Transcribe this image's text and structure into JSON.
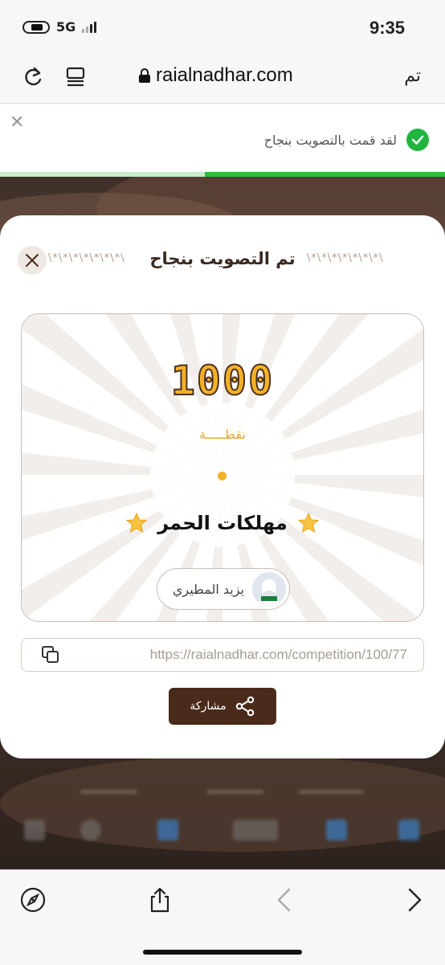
{
  "status_bar": {
    "network": "5G",
    "time": "9:35"
  },
  "browser": {
    "url": "raialnadhar.com",
    "done_label": "تم"
  },
  "toast": {
    "message": "لقد قمت بالتصويت بنجاح",
    "progress": 0.54
  },
  "modal": {
    "title": "تم التصويت بنجاح",
    "decoration": "\\*\\*\\*\\*\\*\\*\\*\\",
    "points": "1000",
    "points_label": "نقطـــــة",
    "team_name": "مهلكات الحمر",
    "user_name": "يزيد المطيري",
    "share_link": "https://raialnadhar.com/competition/100/77",
    "share_label": "مشاركة"
  },
  "colors": {
    "brand_brown": "#4a2b1b",
    "gold": "#f4b128",
    "success_green": "#1fb53f"
  },
  "icons": {
    "status": [
      "battery-icon",
      "signal-icon"
    ],
    "browser": [
      "reload-icon",
      "reader-icon",
      "lock-icon"
    ],
    "toolbar": [
      "compass-icon",
      "share-icon",
      "back-icon",
      "forward-icon"
    ]
  }
}
